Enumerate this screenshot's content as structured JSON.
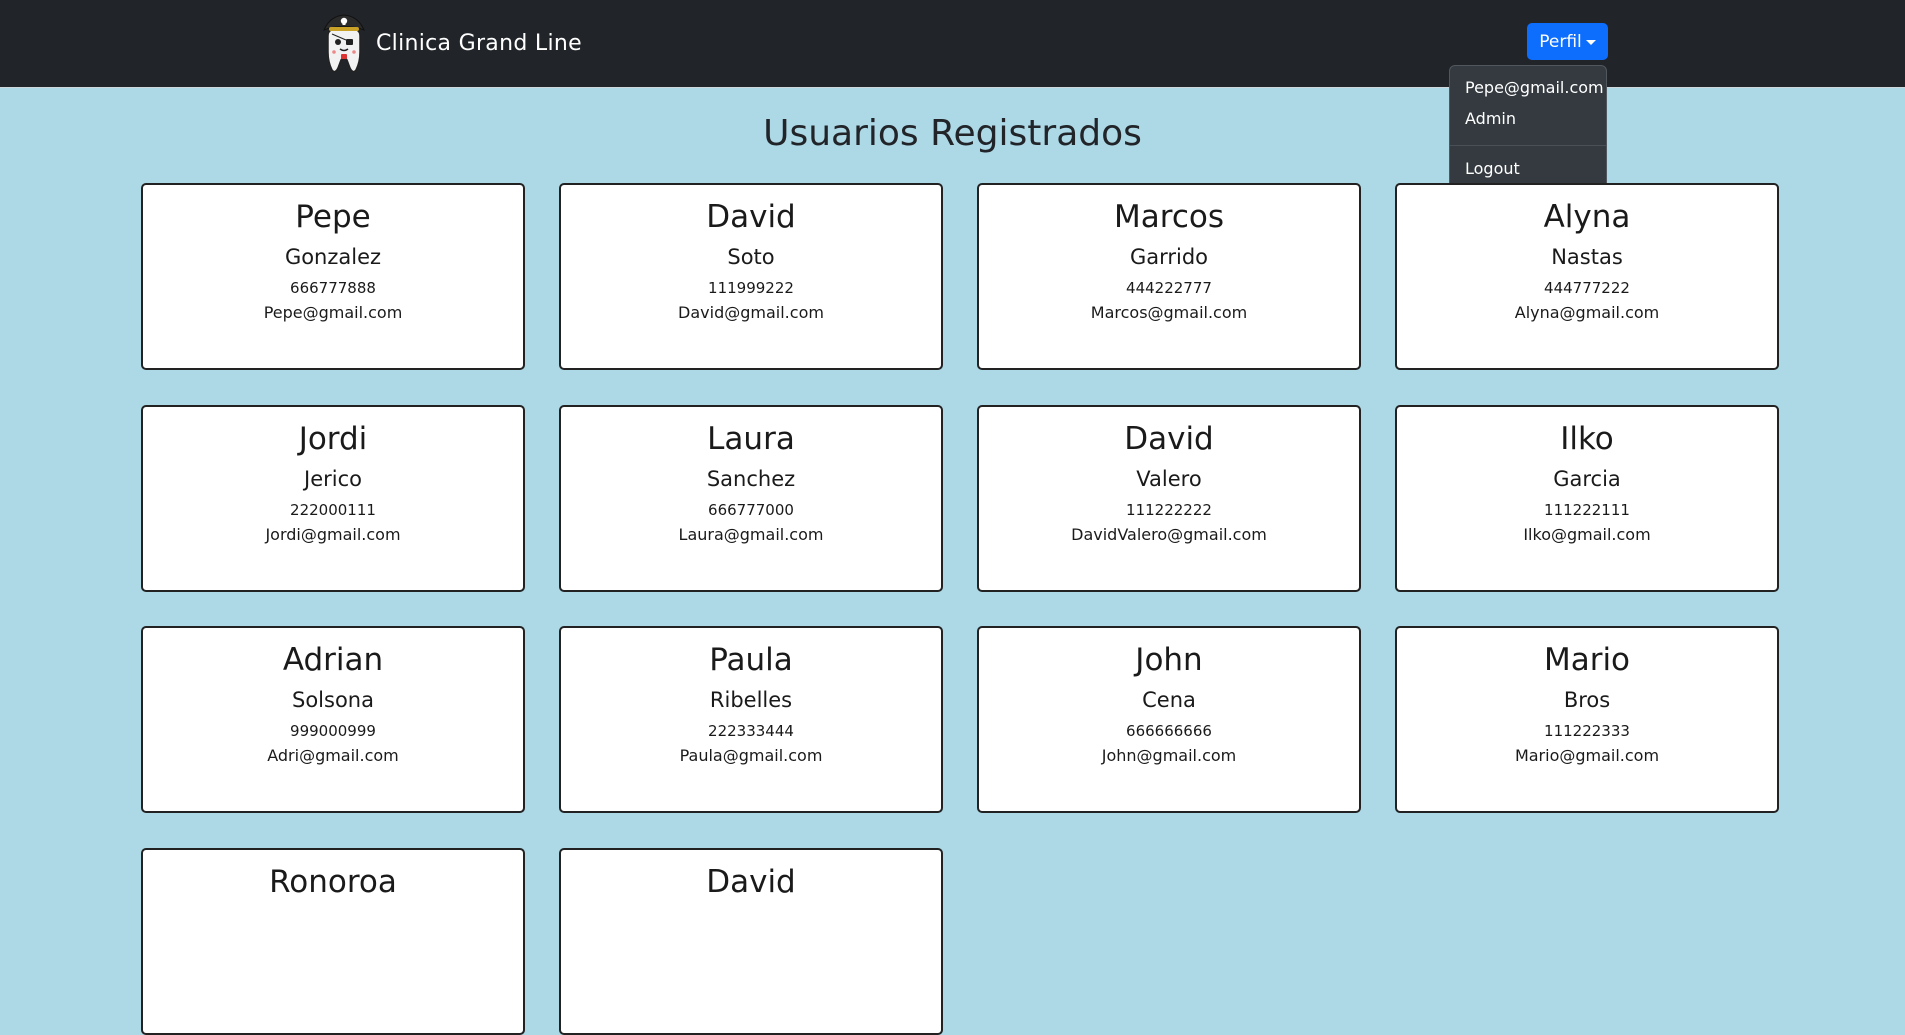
{
  "navbar": {
    "brand": "Clinica Grand Line",
    "profile_button": "Perfil",
    "dropdown": {
      "email": "Pepe@gmail.com",
      "role": "Admin",
      "logout": "Logout"
    }
  },
  "title": "Usuarios Registrados",
  "users": [
    {
      "name": "Pepe",
      "last": "Gonzalez",
      "phone": "666777888",
      "email": "Pepe@gmail.com"
    },
    {
      "name": "David",
      "last": "Soto",
      "phone": "111999222",
      "email": "David@gmail.com"
    },
    {
      "name": "Marcos",
      "last": "Garrido",
      "phone": "444222777",
      "email": "Marcos@gmail.com"
    },
    {
      "name": "Alyna",
      "last": "Nastas",
      "phone": "444777222",
      "email": "Alyna@gmail.com"
    },
    {
      "name": "Jordi",
      "last": "Jerico",
      "phone": "222000111",
      "email": "Jordi@gmail.com"
    },
    {
      "name": "Laura",
      "last": "Sanchez",
      "phone": "666777000",
      "email": "Laura@gmail.com"
    },
    {
      "name": "David",
      "last": "Valero",
      "phone": "111222222",
      "email": "DavidValero@gmail.com"
    },
    {
      "name": "Ilko",
      "last": "Garcia",
      "phone": "111222111",
      "email": "Ilko@gmail.com"
    },
    {
      "name": "Adrian",
      "last": "Solsona",
      "phone": "999000999",
      "email": "Adri@gmail.com"
    },
    {
      "name": "Paula",
      "last": "Ribelles",
      "phone": "222333444",
      "email": "Paula@gmail.com"
    },
    {
      "name": "John",
      "last": "Cena",
      "phone": "666666666",
      "email": "John@gmail.com"
    },
    {
      "name": "Mario",
      "last": "Bros",
      "phone": "111222333",
      "email": "Mario@gmail.com"
    },
    {
      "name": "Ronoroa",
      "last": "",
      "phone": "",
      "email": ""
    },
    {
      "name": "David",
      "last": "",
      "phone": "",
      "email": ""
    }
  ],
  "colors": {
    "navbar": "#212529",
    "page_background": "#add8e6",
    "button_primary": "#0d6efd",
    "dropdown_background": "#343a40",
    "card_border": "#222222"
  },
  "icons": {
    "logo": "pirate-tooth-logo",
    "profile_caret": "caret-down-icon"
  }
}
